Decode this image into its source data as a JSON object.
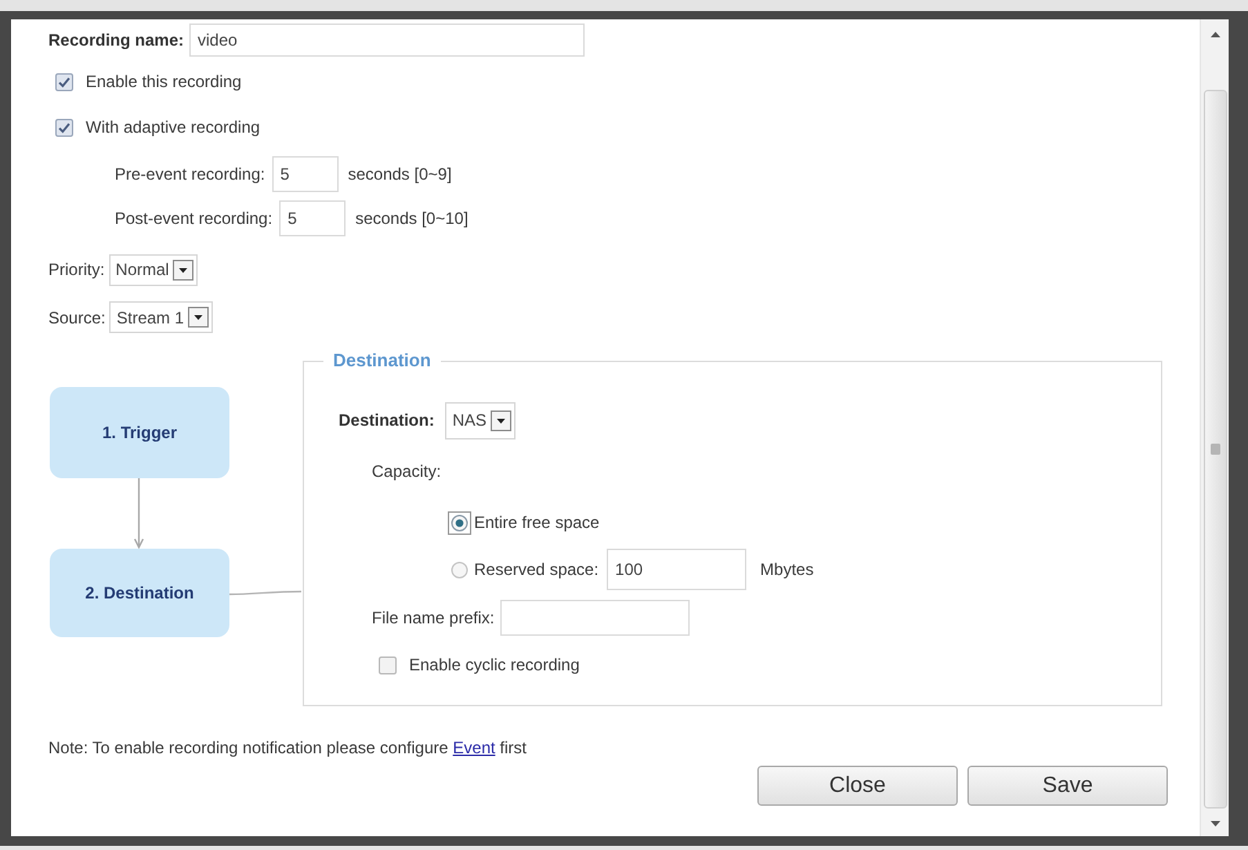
{
  "recording_name": {
    "label": "Recording name:",
    "value": "video"
  },
  "options": [
    {
      "label": "Enable this recording",
      "checked": true
    },
    {
      "label": "With adaptive recording",
      "checked": true
    }
  ],
  "event_times": [
    {
      "label": "Pre-event recording:",
      "value": "5",
      "unit": "seconds [0~9]"
    },
    {
      "label": "Post-event recording:",
      "value": "5",
      "unit": "seconds [0~10]"
    }
  ],
  "selects": [
    {
      "label": "Priority:",
      "value": "Normal"
    },
    {
      "label": "Source:",
      "value": "Stream 1"
    }
  ],
  "steps": [
    {
      "label": "1. Trigger"
    },
    {
      "label": "2. Destination"
    }
  ],
  "destination": {
    "legend": "Destination",
    "field": {
      "label": "Destination:",
      "value": "NAS"
    },
    "capacity": {
      "label": "Capacity:",
      "options": [
        {
          "label": "Entire free space",
          "selected": true
        },
        {
          "label": "Reserved space:",
          "selected": false,
          "value": "100",
          "unit": "Mbytes"
        }
      ]
    },
    "file_name_prefix": {
      "label": "File name prefix:"
    },
    "cyclic": {
      "label": "Enable cyclic recording",
      "checked": false
    }
  },
  "note": {
    "text": "Note: To enable recording notification please configure",
    "link": "Event",
    "after": "first"
  },
  "buttons": [
    "Close",
    "Save"
  ]
}
